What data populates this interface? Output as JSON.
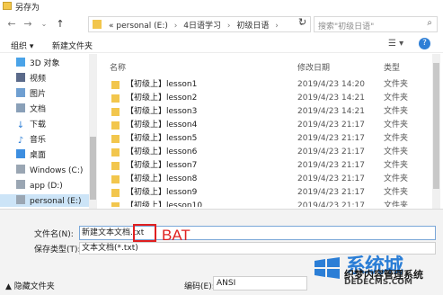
{
  "window": {
    "title": "另存为"
  },
  "address": {
    "root_hint": "«",
    "crumbs": [
      "personal (E:)",
      "4日语学习",
      "初级日语"
    ],
    "separator": "›"
  },
  "search": {
    "placeholder": "搜索\"初级日语\""
  },
  "toolbar": {
    "organize_label": "组织 ▾",
    "new_folder_label": "新建文件夹"
  },
  "nav": {
    "items": [
      {
        "label": "3D 对象",
        "icon": "3d-objects-icon"
      },
      {
        "label": "视频",
        "icon": "video-icon"
      },
      {
        "label": "图片",
        "icon": "pictures-icon"
      },
      {
        "label": "文档",
        "icon": "documents-icon"
      },
      {
        "label": "下载",
        "icon": "download-icon"
      },
      {
        "label": "音乐",
        "icon": "music-icon"
      },
      {
        "label": "桌面",
        "icon": "desktop-icon"
      },
      {
        "label": "Windows (C:)",
        "icon": "drive-icon"
      },
      {
        "label": "app (D:)",
        "icon": "drive-icon"
      },
      {
        "label": "personal (E:)",
        "icon": "drive-icon",
        "selected": true
      }
    ]
  },
  "filelist": {
    "columns": {
      "name": "名称",
      "date": "修改日期",
      "type": "类型"
    },
    "files": [
      {
        "name": "【初级上】lesson1",
        "date": "2019/4/23 14:20",
        "type": "文件夹"
      },
      {
        "name": "【初级上】lesson2",
        "date": "2019/4/23 14:21",
        "type": "文件夹"
      },
      {
        "name": "【初级上】lesson3",
        "date": "2019/4/23 14:21",
        "type": "文件夹"
      },
      {
        "name": "【初级上】lesson4",
        "date": "2019/4/23 21:17",
        "type": "文件夹"
      },
      {
        "name": "【初级上】lesson5",
        "date": "2019/4/23 21:17",
        "type": "文件夹"
      },
      {
        "name": "【初级上】lesson6",
        "date": "2019/4/23 21:17",
        "type": "文件夹"
      },
      {
        "name": "【初级上】lesson7",
        "date": "2019/4/23 21:17",
        "type": "文件夹"
      },
      {
        "name": "【初级上】lesson8",
        "date": "2019/4/23 21:17",
        "type": "文件夹"
      },
      {
        "name": "【初级上】lesson9",
        "date": "2019/4/23 21:17",
        "type": "文件夹"
      },
      {
        "name": "【初级上】lesson10",
        "date": "2019/4/23 21:17",
        "type": "文件夹"
      }
    ]
  },
  "save": {
    "filename_label": "文件名(N):",
    "filename_value": "新建文本文档.txt",
    "filetype_label": "保存类型(T):",
    "filetype_value": "文本文档(*.txt)",
    "hide_folders_label": "隐藏文件夹",
    "encoding_label": "编码(E):",
    "encoding_value": "ANSI"
  },
  "annotation": {
    "text": "BAT",
    "color": "#e02020"
  },
  "watermark": {
    "brand": "系统城",
    "slogan": "织梦内容管理系统",
    "url": "xitongcheng.com",
    "url_overlay": "DEDECMS.COM"
  },
  "colors": {
    "accent": "#2f7fd6",
    "selection": "#cce4f7",
    "folder": "#f2c64d",
    "panel": "#f3f3f3"
  }
}
